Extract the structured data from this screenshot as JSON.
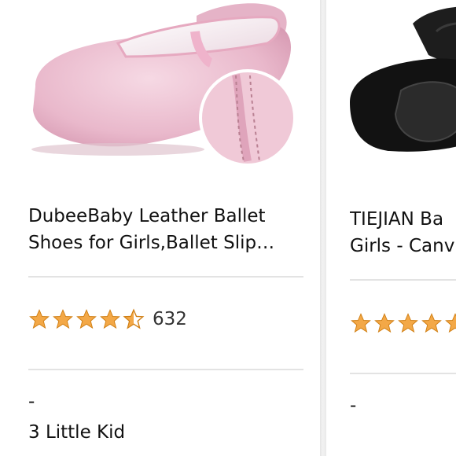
{
  "products": [
    {
      "title_line1": "DubeeBaby Leather Ballet",
      "title_line2": "Shoes for Girls,Ballet Slip…",
      "rating_value": 4.5,
      "review_count": "632",
      "price_dash": "-",
      "size_text": "3 Little Kid",
      "image_icon": "pink-ballet-shoe-image"
    },
    {
      "title_line1": "TIEJIAN Ba",
      "title_line2": "Girls - Canv",
      "rating_value": 4.5,
      "price_dash": "-",
      "image_icon": "black-canvas-ballet-shoe-image"
    }
  ],
  "colors": {
    "star": "#f3a847",
    "star_outline": "#d07e12",
    "divider": "#e3e3e3",
    "text": "#111111"
  }
}
